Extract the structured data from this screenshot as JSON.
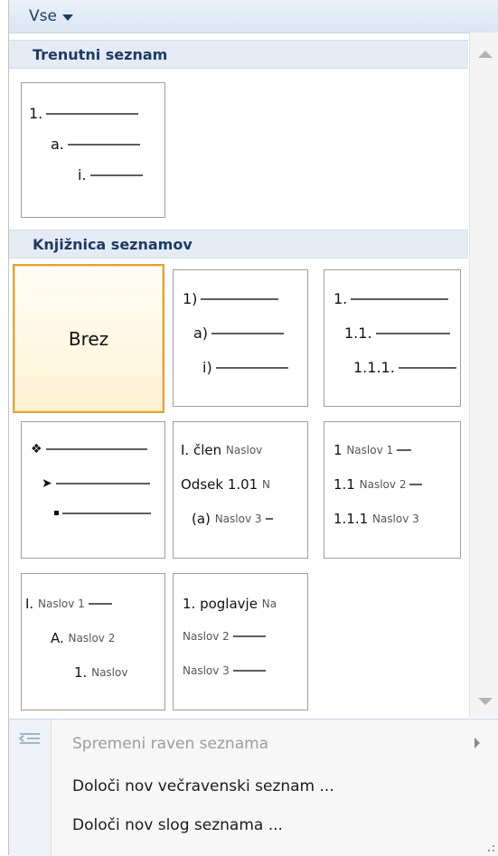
{
  "filter": {
    "label": "Vse"
  },
  "sections": {
    "current": "Trenutni seznam",
    "library": "Knjižnica seznamov"
  },
  "current_list": {
    "l1": "1.",
    "l2": "a.",
    "l3": "i."
  },
  "library": {
    "none": "Brez",
    "t2": {
      "l1": "1)",
      "l2": "a)",
      "l3": "i)"
    },
    "t3": {
      "l1": "1.",
      "l2": "1.1.",
      "l3": "1.1.1."
    },
    "t5": {
      "l1a": "I. člen",
      "l1b": "Naslov",
      "l2a": "Odsek 1.01",
      "l2b": "N",
      "l3a": "(a)",
      "l3b": "Naslov 3"
    },
    "t6": {
      "l1a": "1",
      "l1b": "Naslov 1",
      "l2a": "1.1",
      "l2b": "Naslov 2",
      "l3a": "1.1.1",
      "l3b": "Naslov 3"
    },
    "t7": {
      "l1a": "I.",
      "l1b": "Naslov 1",
      "l2a": "A.",
      "l2b": "Naslov 2",
      "l3a": "1.",
      "l3b": "Naslov"
    },
    "t8": {
      "l1a": "1. poglavje",
      "l1b": "Na",
      "l2": "Naslov 2",
      "l3": "Naslov 3"
    }
  },
  "menu": {
    "change_level": "Spremeni raven seznama",
    "define_multilevel": "Določi nov večravenski seznam ...",
    "define_style": "Določi nov slog seznama ..."
  }
}
